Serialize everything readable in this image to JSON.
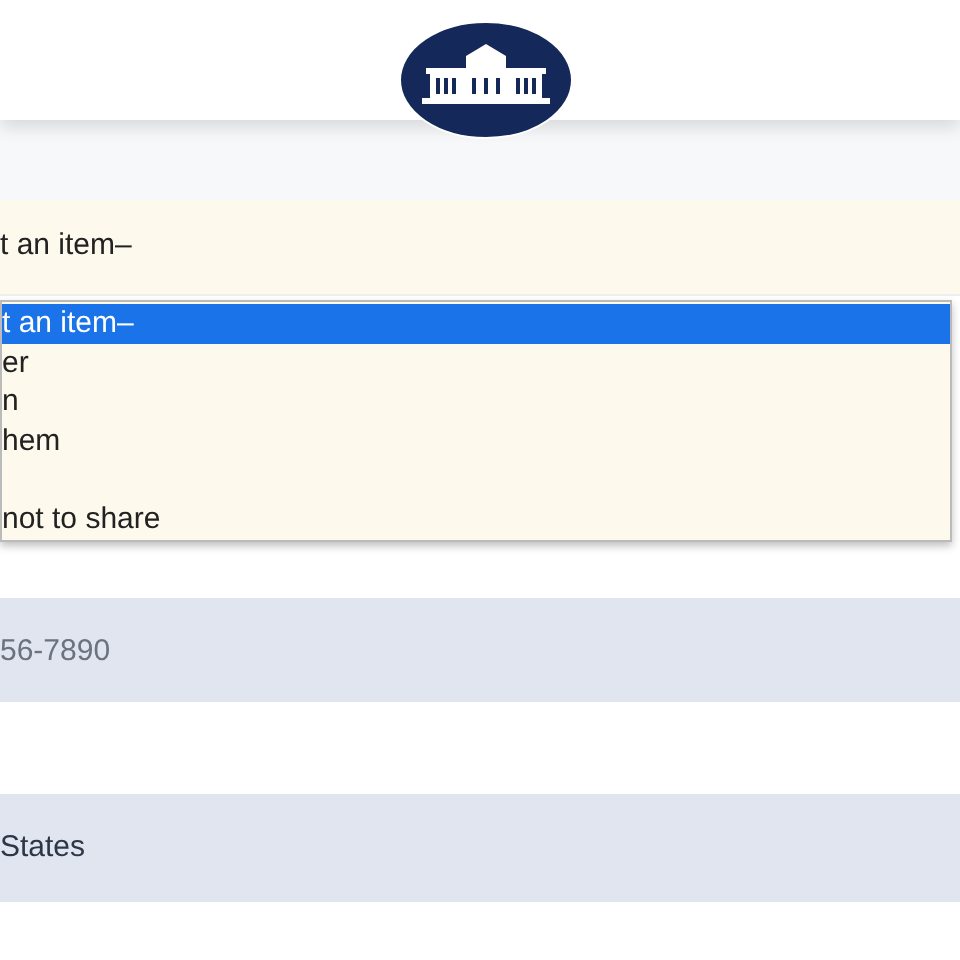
{
  "header": {
    "logo": {
      "kind": "emblem"
    }
  },
  "select": {
    "value": "t an item–",
    "expanded": true,
    "options": [
      {
        "kind": "text",
        "label": "t an item–",
        "selected": true
      },
      {
        "kind": "text",
        "label": "er",
        "selected": false
      },
      {
        "kind": "text",
        "label": "n",
        "selected": false
      },
      {
        "kind": "text",
        "label": "hem",
        "selected": false
      },
      {
        "kind": "blank"
      },
      {
        "kind": "text",
        "label": "not to share",
        "selected": false
      }
    ]
  },
  "phone": {
    "placeholder": "56-7890"
  },
  "country": {
    "value": "States"
  }
}
